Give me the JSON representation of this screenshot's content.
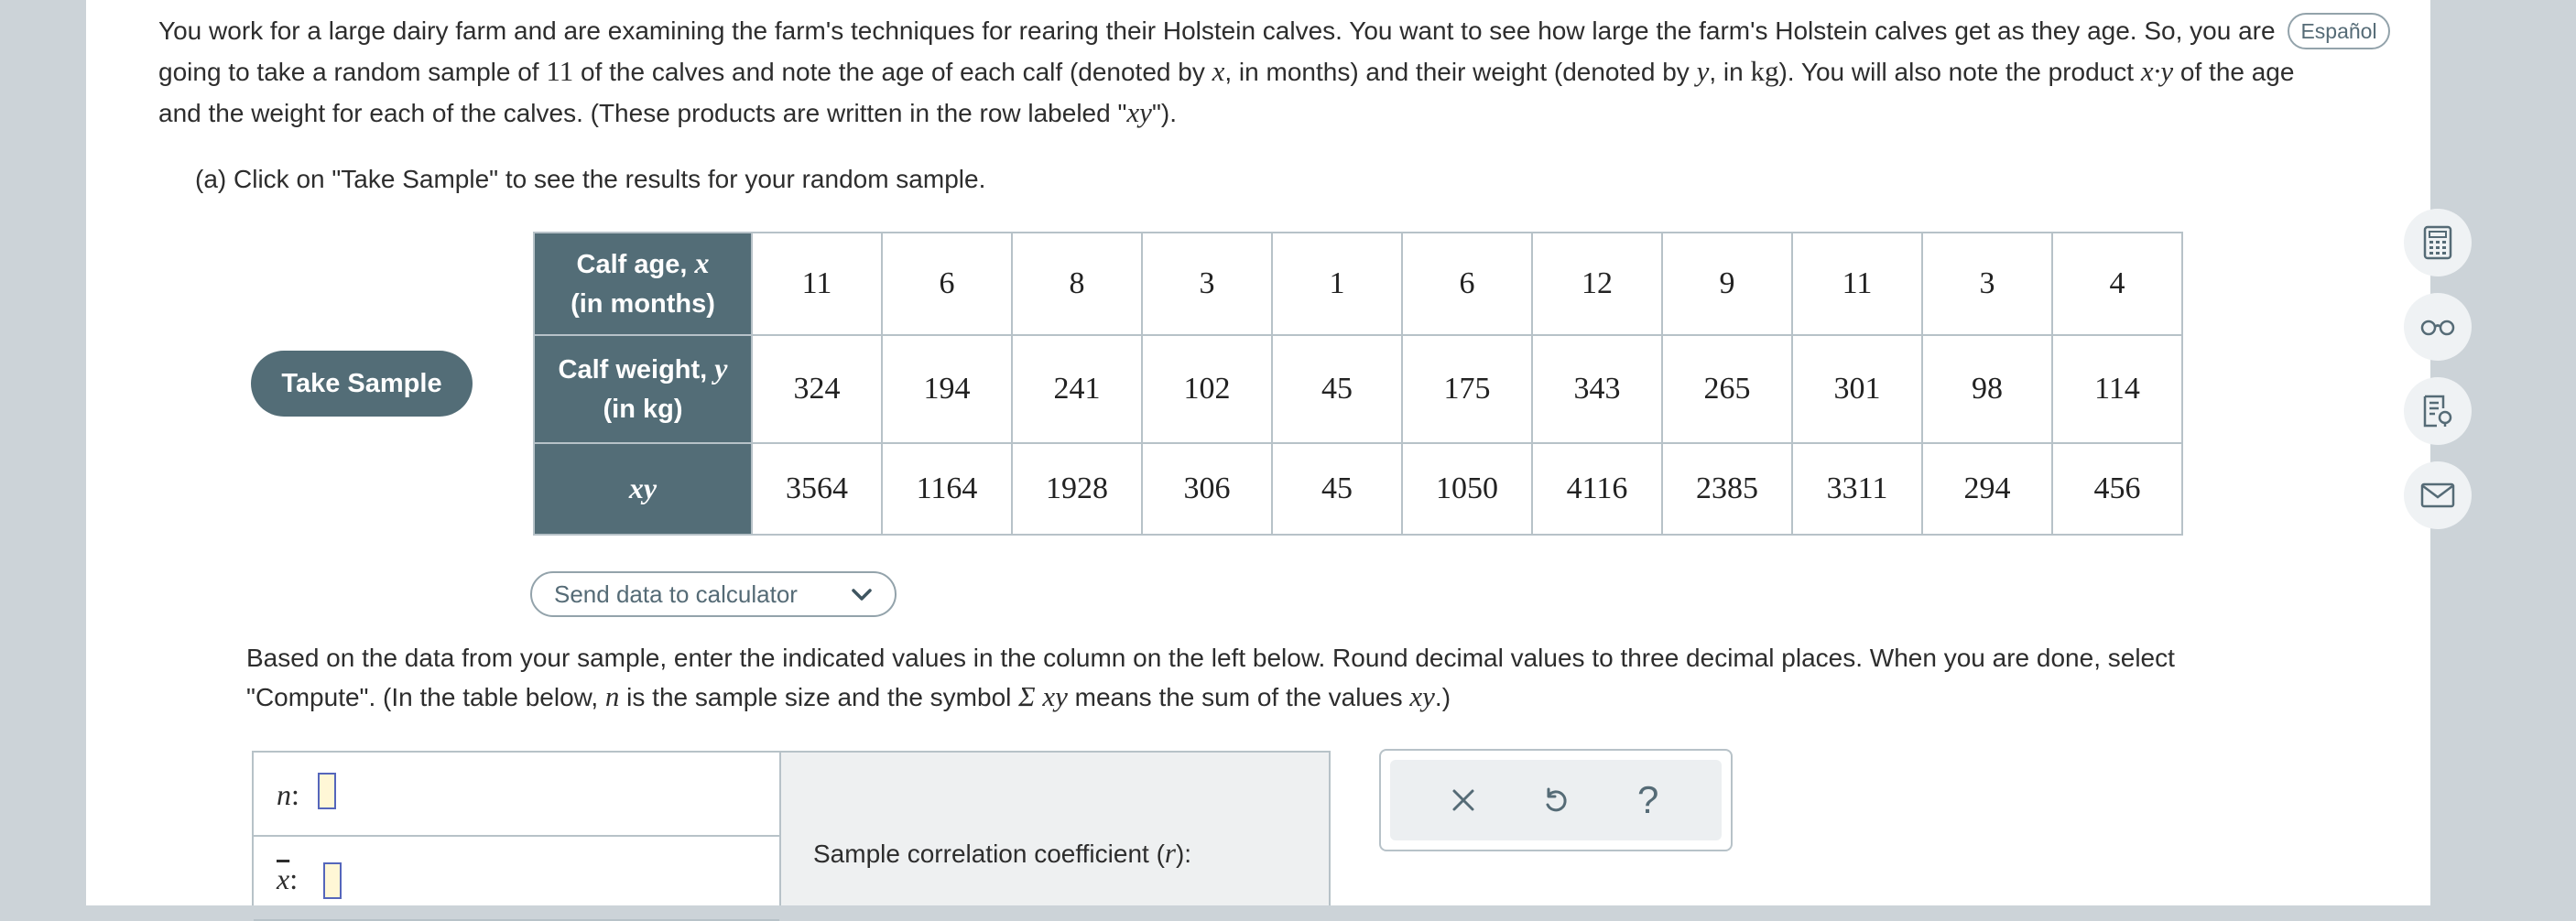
{
  "problem": {
    "intro": {
      "s1": "You work for a large dairy farm and are examining the farm's techniques for rearing their Holstein calves. You want to see how large the farm's Holstein calves get as they age. So, you are going to take a random sample of ",
      "n": "11",
      "s2": " of the calves and note the age of each calf (denoted by ",
      "x": "x",
      "s3": ", in months) and their weight (denoted by ",
      "y": "y",
      "s4": ", in ",
      "kg": "kg",
      "s5": "). You will also note the product ",
      "xy_dot": "x·y",
      "s6": " of the age and the weight for each of the calves. (These products are written in the row labeled \"",
      "xy": "xy",
      "s7": "\")."
    },
    "language_button": "Español",
    "part_a": "(a) Click on \"Take Sample\" to see the results for your random sample."
  },
  "sample": {
    "take_button": "Take Sample",
    "rows": [
      {
        "label_pre": "Calf age, ",
        "var": "x",
        "label_post": "(in months)",
        "values": [
          "11",
          "6",
          "8",
          "3",
          "1",
          "6",
          "12",
          "9",
          "11",
          "3",
          "4"
        ]
      },
      {
        "label_pre": "Calf weight, ",
        "var": "y",
        "label_post": "(in kg)",
        "values": [
          "324",
          "194",
          "241",
          "102",
          "45",
          "175",
          "343",
          "265",
          "301",
          "98",
          "114"
        ]
      },
      {
        "var": "xy",
        "values": [
          "3564",
          "1164",
          "1928",
          "306",
          "45",
          "1050",
          "4116",
          "2385",
          "3311",
          "294",
          "456"
        ]
      }
    ],
    "send_button": "Send data to calculator"
  },
  "instructions": {
    "t1": "Based on the data from your sample, enter the indicated values in the column on the left below. Round decimal values to three decimal places. When you are done, select \"Compute\". (In the table below, ",
    "n": "n",
    "t2": " is the sample size and the symbol ",
    "sigma": "Σ xy",
    "t3": " means the sum of the values ",
    "xy": "xy",
    "t4": ".)"
  },
  "answer": {
    "n_label": "n",
    "xbar_label": "x",
    "colon": ":",
    "n_value": "",
    "xbar_value": "",
    "corr_pre": "Sample correlation coefficient (",
    "corr_var": "r",
    "corr_post": "):"
  },
  "toolbar": {
    "close_glyph": "✕",
    "undo_glyph": "↺",
    "help_glyph": "?"
  },
  "side_icons": [
    "calculator-icon",
    "glasses-icon",
    "notes-icon",
    "mail-icon"
  ]
}
